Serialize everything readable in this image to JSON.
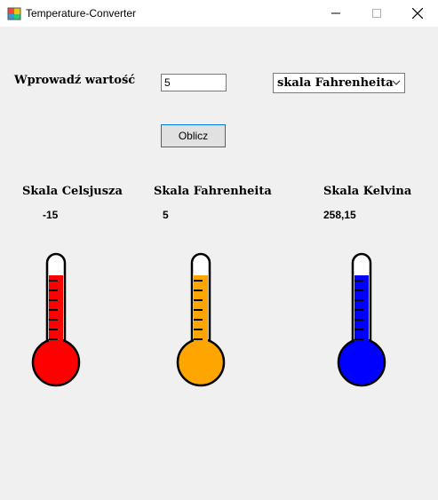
{
  "window": {
    "title": "Temperature-Converter",
    "icons": [
      "app-icon",
      "minimize-icon",
      "maximize-icon",
      "close-icon"
    ]
  },
  "form": {
    "input_label": "Wprowadź wartość",
    "input_value": "5",
    "scale_selected": "skala Fahrenheita",
    "calculate_label": "Oblicz"
  },
  "results": [
    {
      "label": "Skala Celsjusza",
      "value": "-15",
      "color": "#ff0000"
    },
    {
      "label": "Skala Fahrenheita",
      "value": "5",
      "color": "#ffa500"
    },
    {
      "label": "Skala Kelvina",
      "value": "258,15",
      "color": "#0000ff"
    }
  ]
}
